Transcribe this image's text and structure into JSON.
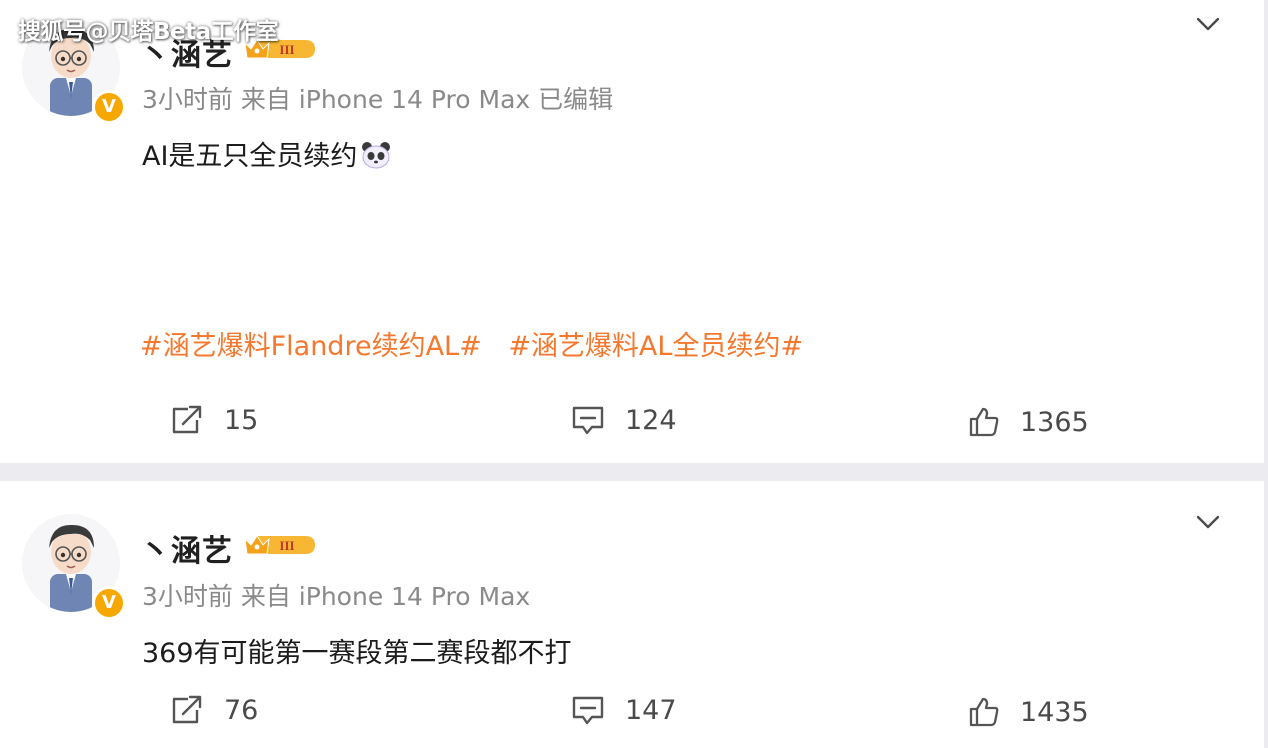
{
  "watermark": "搜狐号@贝塔Beta工作室",
  "colors": {
    "tag": "#f4782e",
    "verified": "#f7a800",
    "meta": "#8a8a8a",
    "background": "#ececf0"
  },
  "icons": [
    "chevron-down-icon",
    "repost-icon",
    "comment-icon",
    "like-icon",
    "verified-badge",
    "vip-crown-badge",
    "panda-emoji"
  ],
  "posts": [
    {
      "username": "丶涵艺",
      "time": "3小时前",
      "source": "来自 iPhone 14 Pro Max",
      "edited": "已编辑",
      "content": "AI是五只全员续约",
      "tags": [
        "#涵艺爆料Flandre续约AL#",
        "#涵艺爆料AL全员续约#"
      ],
      "reposts": "15",
      "comments": "124",
      "likes": "1365"
    },
    {
      "username": "丶涵艺",
      "time": "3小时前",
      "source": "来自 iPhone 14 Pro Max",
      "content": "369有可能第一赛段第二赛段都不打",
      "reposts": "76",
      "comments": "147",
      "likes": "1435"
    }
  ]
}
